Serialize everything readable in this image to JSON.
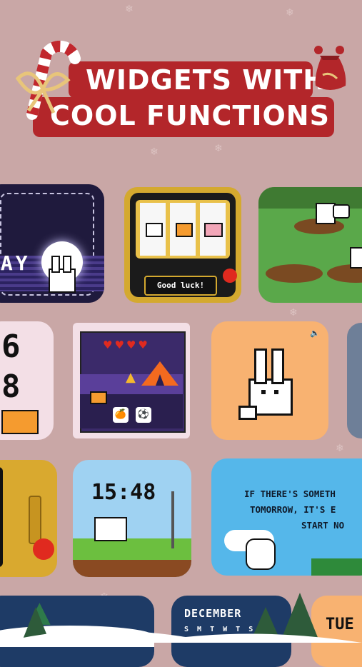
{
  "header": {
    "line1": "WIDGETS WITH",
    "line2": "COOL FUNCTIONS"
  },
  "widgets": {
    "night_label": "DAY",
    "slot_button": "Good luck!",
    "game_hearts": "♥♥♥♥",
    "game_fruit_icon": "🍊",
    "game_ball_icon": "⚽",
    "clock_digits_partial": [
      "6",
      "8"
    ],
    "pixel_clock_time": "15:48",
    "quote_lines": [
      "IF THERE'S SOMETH",
      "TOMORROW, IT'S E",
      "START NO"
    ],
    "calendar_month": "DECEMBER",
    "calendar_weekdays": "S M T W T S",
    "weekday_label": "TUE"
  },
  "colors": {
    "background": "#c9a7a6",
    "banner": "#b3262a",
    "accent_orange": "#f8b271",
    "quote_bg": "#55b7ea"
  }
}
